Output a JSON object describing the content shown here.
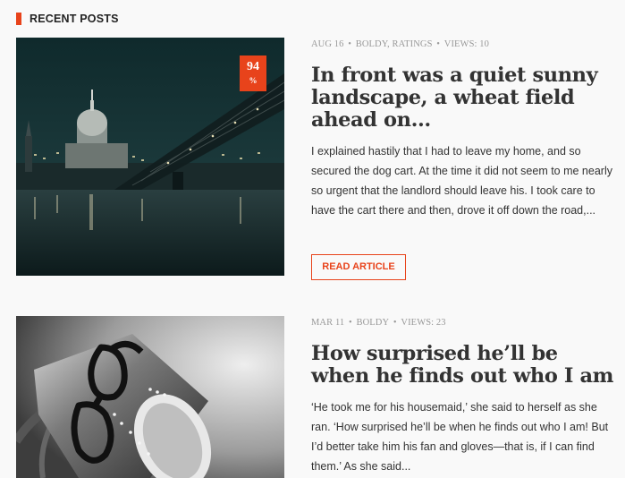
{
  "section": {
    "title": "RECENT POSTS"
  },
  "posts": [
    {
      "meta": {
        "date": "AUG 16",
        "categories": "BOLDY, RATINGS",
        "views": "VIEWS: 10"
      },
      "score": {
        "value": "94",
        "unit": "%"
      },
      "title": "In front was a quiet sunny landscape, a wheat field ahead on...",
      "excerpt": "I explained hastily that I had to leave my home, and so secured the dog cart. At the time it did not seem to me nearly so urgent that the landlord should leave his. I took care to have the cart there and then, drove it off down the road,...",
      "read_more": "READ ARTICLE"
    },
    {
      "meta": {
        "date": "MAR 11",
        "categories": "BOLDY",
        "views": "VIEWS: 23"
      },
      "title": "How surprised he’ll be when he finds out who I am",
      "excerpt": "‘He took me for his housemaid,’ she said to herself as she ran. ‘How surprised he’ll be when he finds out who I am! But I’d better take him his fan and gloves—that is, if I can find them.’ As she said..."
    }
  ],
  "colors": {
    "accent": "#e8431b",
    "meta": "#999999",
    "text": "#333333",
    "background": "#f9f9f9"
  }
}
